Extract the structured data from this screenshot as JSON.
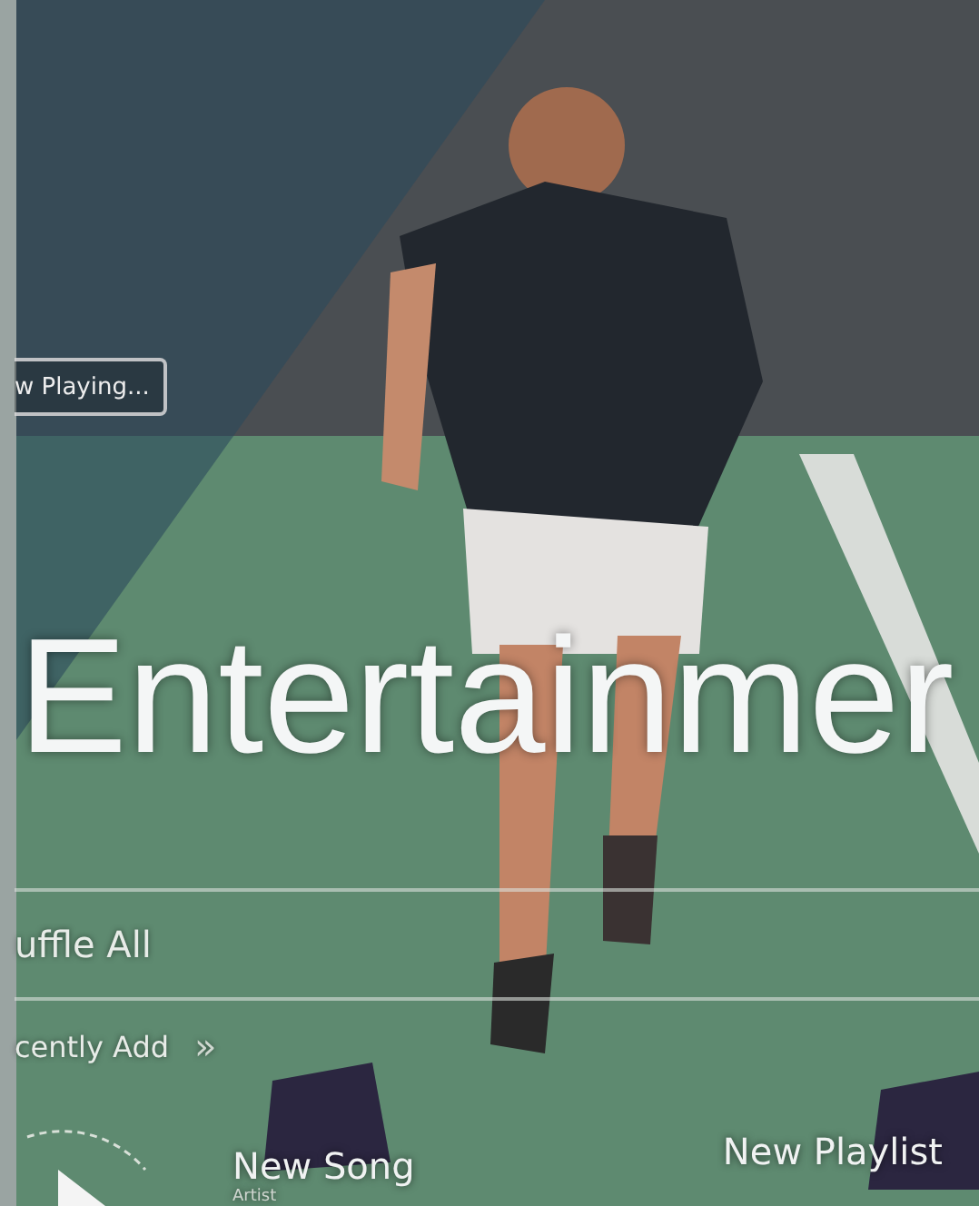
{
  "now_playing": {
    "label": "w Playing..."
  },
  "title": "Entertainmer",
  "menu": [
    {
      "label": "uffle All"
    },
    {
      "label": "cently Add",
      "arrow_text": "»"
    }
  ],
  "tracks": [
    {
      "title": "New Song",
      "subtitle": "Artist"
    },
    {
      "title": "New Playlist"
    }
  ]
}
